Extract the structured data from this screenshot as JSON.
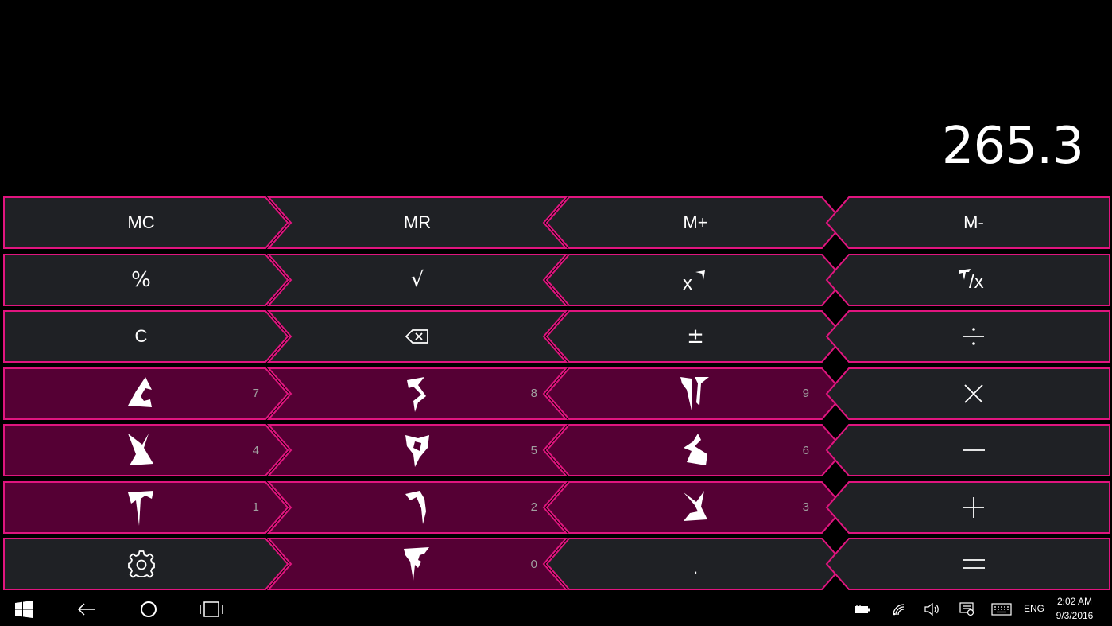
{
  "display": {
    "value": "265.3"
  },
  "keys": {
    "mc": "MC",
    "mr": "MR",
    "mplus": "M+",
    "mminus": "M-",
    "percent": "%",
    "sqrt": "√",
    "clear": "C",
    "plusminus": "±",
    "digits": {
      "d7": "7",
      "d8": "8",
      "d9": "9",
      "d4": "4",
      "d5": "5",
      "d6": "6",
      "d1": "1",
      "d2": "2",
      "d3": "3",
      "d0": "0"
    },
    "decimal": "."
  },
  "icons": {
    "square": "square-icon",
    "reciprocal": "reciprocal-icon",
    "backspace": "backspace-icon",
    "divide": "divide-icon",
    "multiply": "multiply-icon",
    "minus": "minus-icon",
    "plus": "plus-icon",
    "equals": "equals-icon",
    "settings": "gear-icon"
  },
  "taskbar": {
    "language": "ENG",
    "time": "2:02 AM",
    "date": "9/3/2016"
  },
  "colors": {
    "accent": "#e0157f",
    "digit_fill": "#550034",
    "function_fill": "#1f2125",
    "background": "#000000"
  }
}
